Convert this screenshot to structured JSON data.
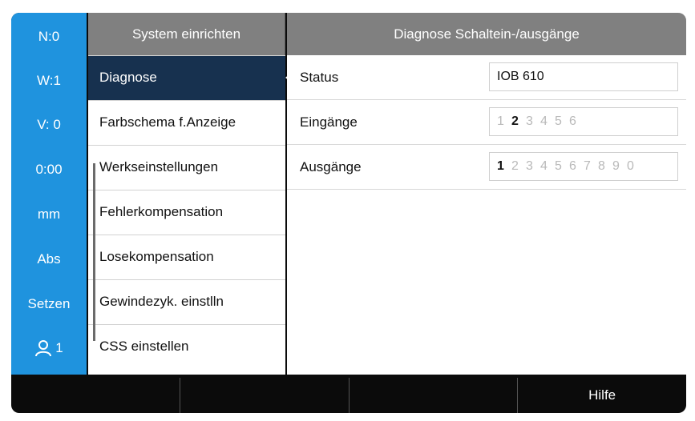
{
  "status_bar": {
    "datum": "N:0",
    "tool": "W:1",
    "feed": "V:  0",
    "timer": "0:00",
    "unit": "mm",
    "mode": "Abs",
    "setzen": "Setzen",
    "user": "1"
  },
  "menu": {
    "title": "System einrichten",
    "items": [
      {
        "label": "Diagnose",
        "selected": true
      },
      {
        "label": "Farbschema f.Anzeige"
      },
      {
        "label": "Werkseinstellungen"
      },
      {
        "label": "Fehlerkompensation"
      },
      {
        "label": "Losekompensation"
      },
      {
        "label": "Gewindezyk. einstlln"
      },
      {
        "label": "CSS einstellen"
      }
    ]
  },
  "detail": {
    "title": "Diagnose Schaltein-/ausgänge",
    "status": {
      "label": "Status",
      "value": "IOB 610"
    },
    "inputs": {
      "label": "Eingänge",
      "pins": [
        "1",
        "2",
        "3",
        "4",
        "5",
        "6"
      ],
      "active": [
        "2"
      ]
    },
    "outputs": {
      "label": "Ausgänge",
      "pins": [
        "1",
        "2",
        "3",
        "4",
        "5",
        "6",
        "7",
        "8",
        "9",
        "0"
      ],
      "active": [
        "1"
      ]
    }
  },
  "softkeys": [
    "",
    "",
    "",
    "Hilfe"
  ],
  "colors": {
    "status_bar": "#1f93de",
    "header": "#808080",
    "selected": "#17314f"
  }
}
